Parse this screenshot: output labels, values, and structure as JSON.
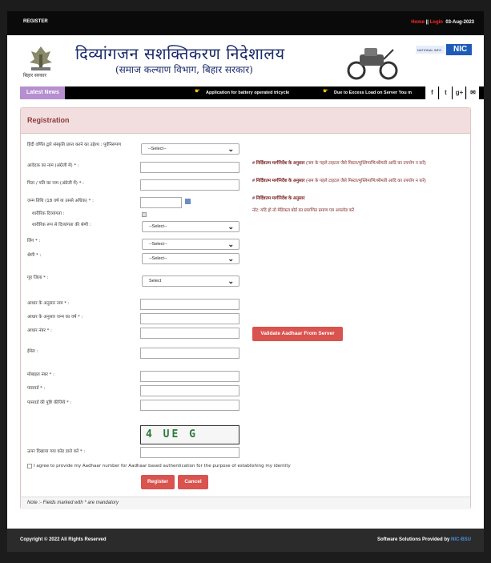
{
  "topbar": {
    "register": "REGISTER",
    "home": "Home",
    "sep": "||",
    "login": "Login",
    "date": "03-Aug-2023"
  },
  "header": {
    "emblem_caption": "बिहार सरकार",
    "title": "दिव्यांगजन सशक्तिकरण निदेशालय",
    "subtitle": "(समाज कल्याण विभाग, बिहार सरकार)",
    "nic_label": "NIC"
  },
  "news": {
    "label": "Latest News",
    "items": [
      "Application for battery operated tricycle",
      "Due to Excess Load on Server You m"
    ],
    "social": [
      "f",
      "t",
      "g+",
      "✉"
    ]
  },
  "form": {
    "heading": "Registration",
    "fields": [
      {
        "label": "हिंदी वर्णित द्वारे संस्कृति प्राप्त करने का उद्देश्य : पूर्वनिरूपण",
        "select": "--Select--"
      },
      {
        "label": "आवेदक का नाम (अंग्रेजी में) * :"
      },
      {
        "label": "पिता / पति का नाम (अंग्रेजी में) * :"
      },
      {
        "label": "जन्म तिथि (18 वर्ष या उससे अधिक) * :"
      },
      {
        "label": "शारीरिक दिव्यांगता :"
      },
      {
        "label": "शारीरिक रूप से दिव्यांगता की श्रेणी :",
        "select": "--Select--"
      },
      {
        "label": "लिंग * :",
        "select": "--Select--"
      },
      {
        "label": "श्रेणी * :",
        "select": "--Select--"
      },
      {
        "label": "गृह जिला * :",
        "select": "Select"
      },
      {
        "label": "आधार के अनुसार नाम * :"
      },
      {
        "label": "आधार के अनुसार जन्म का वर्ष * :"
      },
      {
        "label": "आधार नंबर * :"
      },
      {
        "label": "ईमेल :"
      },
      {
        "label": "मोबाइल नंबर * :"
      },
      {
        "label": "पासवर्ड * :"
      },
      {
        "label": "पासवर्ड की पुष्टि कीजिये * :"
      },
      {
        "label": "ऊपर दिखाया गया कोड डाले करें * :"
      }
    ],
    "notes": {
      "n1_bold": "# निर्दिष्टतम मार्गनिर्देश के अनुसार",
      "n1_rest": " (नाम के पहले टाइटल जैसे मिस्टर/मुस्लिमाणि/श्रीमती आदि का उपयोग न करें)",
      "n2_bold": "# निर्दिष्टतम मार्गनिर्देश के अनुसार",
      "n2_rest": " (नाम के पहले टाइटल जैसे मिस्टर/मुस्लिमाणि/श्रीमती आदि का उपयोग न करें)",
      "n3_bold": "# निर्दिष्टतम मार्गनिर्देश के अनुसार",
      "n4": "नोट: यदि हो तो मेडिकल बोर्ड का प्रमाणित प्रमाण पत्र अपलोड करें"
    },
    "validate_label": "Validate Aadhaar From Server",
    "captcha": "4 UE G",
    "consent": "I agree to provide my Aadhaar number for Aadhaar based authentication for the purpose of establishing my identity",
    "register_label": "Register",
    "cancel_label": "Cancel",
    "footnote": "Note :- Fields marked with * are mandatory"
  },
  "footer": {
    "copyright": "Copyright © 2022 All Rights Reserved",
    "provider_prefix": "Software Solutions Provided by ",
    "provider": "NIC-BSU"
  }
}
